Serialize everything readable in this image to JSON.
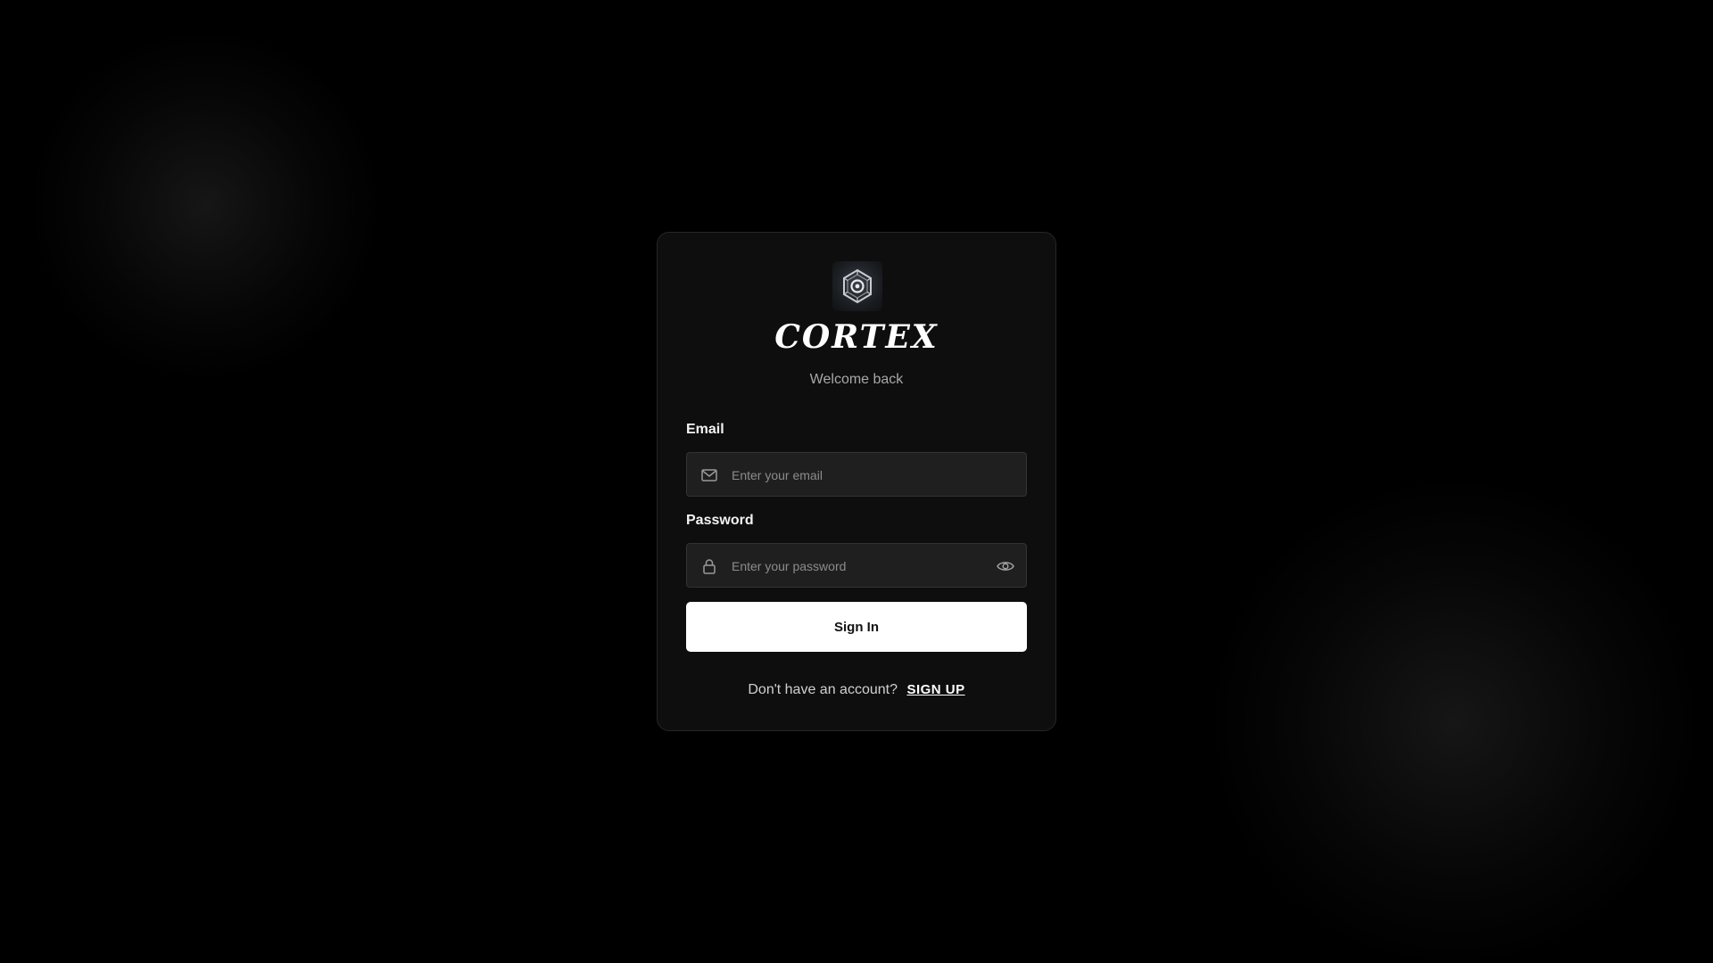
{
  "brand": {
    "name": "CORTEX",
    "subtitle": "Welcome back"
  },
  "form": {
    "email": {
      "label": "Email",
      "placeholder": "Enter your email",
      "value": ""
    },
    "password": {
      "label": "Password",
      "placeholder": "Enter your password",
      "value": ""
    },
    "submit_label": "Sign In"
  },
  "footer": {
    "prompt": "Don't have an account?",
    "link_label": "SIGN UP"
  },
  "icons": {
    "logo": "cortex-logo-icon",
    "email": "mail-icon",
    "password": "lock-icon",
    "toggle": "eye-icon"
  },
  "colors": {
    "background": "#000000",
    "card": "#0e0e0e",
    "input": "#1f1f1f",
    "button": "#ffffff",
    "muted_text": "#a8a8a8"
  }
}
